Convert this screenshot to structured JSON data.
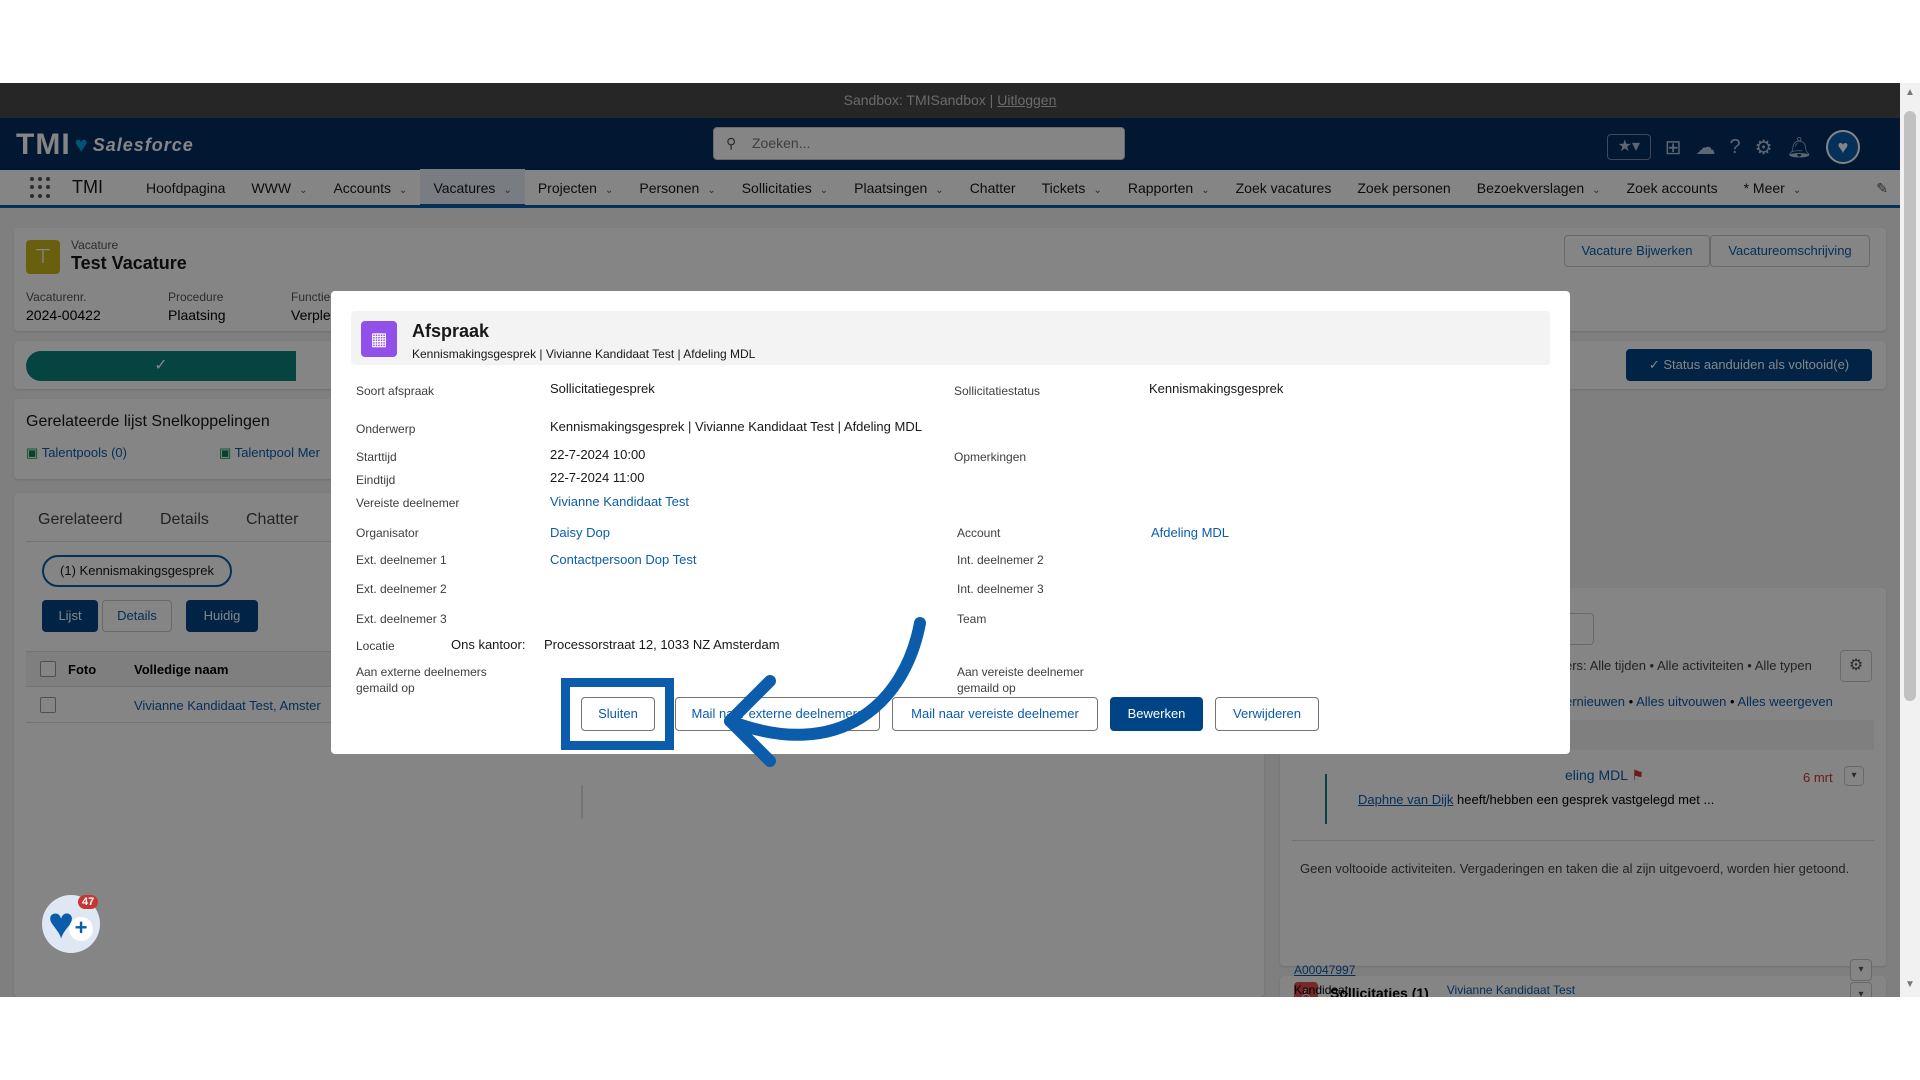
{
  "sandbox": {
    "prefix": "Sandbox: TMISandbox |",
    "logout": "Uitloggen"
  },
  "header": {
    "logo": "TMI",
    "brand": "Salesforce",
    "search_placeholder": "Zoeken..."
  },
  "nav": {
    "app_name": "TMI",
    "items": [
      {
        "label": "Hoofdpagina",
        "dropdown": false
      },
      {
        "label": "WWW",
        "dropdown": true
      },
      {
        "label": "Accounts",
        "dropdown": true
      },
      {
        "label": "Vacatures",
        "dropdown": true,
        "active": true
      },
      {
        "label": "Projecten",
        "dropdown": true
      },
      {
        "label": "Personen",
        "dropdown": true
      },
      {
        "label": "Sollicitaties",
        "dropdown": true
      },
      {
        "label": "Plaatsingen",
        "dropdown": true
      },
      {
        "label": "Chatter",
        "dropdown": false
      },
      {
        "label": "Tickets",
        "dropdown": true
      },
      {
        "label": "Rapporten",
        "dropdown": true
      },
      {
        "label": "Zoek vacatures",
        "dropdown": false
      },
      {
        "label": "Zoek personen",
        "dropdown": false
      },
      {
        "label": "Bezoekverslagen",
        "dropdown": true
      },
      {
        "label": "Zoek accounts",
        "dropdown": false
      },
      {
        "label": "* Meer",
        "dropdown": true
      }
    ]
  },
  "record": {
    "object": "Vacature",
    "name": "Test Vacature",
    "fields": [
      {
        "label": "Vacaturenr.",
        "value": "2024-00422"
      },
      {
        "label": "Procedure",
        "value": "Plaatsing"
      },
      {
        "label": "Functie TMI",
        "value": "Verple"
      }
    ],
    "buttons": [
      "Vacature Bijwerken",
      "Vacatureomschrijving"
    ],
    "status_button": "Status aanduiden als voltooid(e)"
  },
  "related": {
    "title": "Gerelateerde lijst Snelkoppelingen",
    "links": [
      "Talentpools (0)",
      "Talentpool Mer"
    ],
    "tabs": [
      "Gerelateerd",
      "Details",
      "Chatter"
    ],
    "filter_pill": "(1) Kennismakingsgesprek",
    "view_buttons": [
      "Lijst",
      "Details",
      "Huidig"
    ],
    "columns": [
      "Foto",
      "Volledige naam"
    ],
    "row_name": "Vivianne Kandidaat Test, Amster"
  },
  "activity": {
    "filters": "ers: Alle tijden • Alle activiteiten • Alle typen",
    "actions": [
      "ernieuwen",
      "Alles uitvouwen",
      "Alles weergeven"
    ],
    "item_title": "eling MDL",
    "item_date": "6 mrt",
    "item_user": "Daphne van Dijk",
    "item_text": "heeft/hebben een gesprek vastgelegd met ...",
    "empty_text": "Geen voltooide activiteiten. Vergaderingen en taken die al zijn uitgevoerd, worden hier getoond."
  },
  "sollicitaties": {
    "title": "Sollicitaties (1)",
    "record": "A00047997",
    "kandidaat_label": "Kandidaat:",
    "kandidaat_value": "Vivianne Kandidaat Test"
  },
  "modal": {
    "title": "Afspraak",
    "subtitle": "Kennismakingsgesprek | Vivianne Kandidaat Test | Afdeling MDL",
    "fields": {
      "soort_label": "Soort afspraak",
      "soort_value": "Sollicitatiegesprek",
      "status_label": "Sollicitatiestatus",
      "status_value": "Kennismakingsgesprek",
      "onderwerp_label": "Onderwerp",
      "onderwerp_value": "Kennismakingsgesprek | Vivianne Kandidaat Test | Afdeling MDL",
      "start_label": "Starttijd",
      "start_value": "22-7-2024 10:00",
      "opm_label": "Opmerkingen",
      "eind_label": "Eindtijd",
      "eind_value": "22-7-2024 11:00",
      "vereist_label": "Vereiste deelnemer",
      "vereist_value": "Vivianne Kandidaat Test",
      "org_label": "Organisator",
      "org_value": "Daisy Dop",
      "account_label": "Account",
      "account_value": "Afdeling MDL",
      "ext1_label": "Ext. deelnemer 1",
      "ext1_value": "Contactpersoon Dop Test",
      "int2_label": "Int. deelnemer 2",
      "ext2_label": "Ext. deelnemer 2",
      "int3_label": "Int. deelnemer 3",
      "ext3_label": "Ext. deelnemer 3",
      "team_label": "Team",
      "locatie_label": "Locatie",
      "locatie_sub": "Ons kantoor:",
      "locatie_value": "Processorstraat 12, 1033 NZ Amsterdam",
      "mail_ext_label_1": "Aan externe deelnemers",
      "mail_ext_label_2": "gemaild op",
      "mail_ver_label_1": "Aan vereiste deelnemer",
      "mail_ver_label_2": "gemaild op"
    },
    "buttons": {
      "close": "Sluiten",
      "mail_ext": "Mail naar externe deelnemers",
      "mail_ver": "Mail naar vereiste deelnemer",
      "edit": "Bewerken",
      "delete": "Verwijderen"
    }
  },
  "notification_count": "47",
  "colors": {
    "brand": "#032d60",
    "accent": "#0b5cab",
    "event_icon": "#9050e9",
    "annotation": "#0b5cab"
  }
}
